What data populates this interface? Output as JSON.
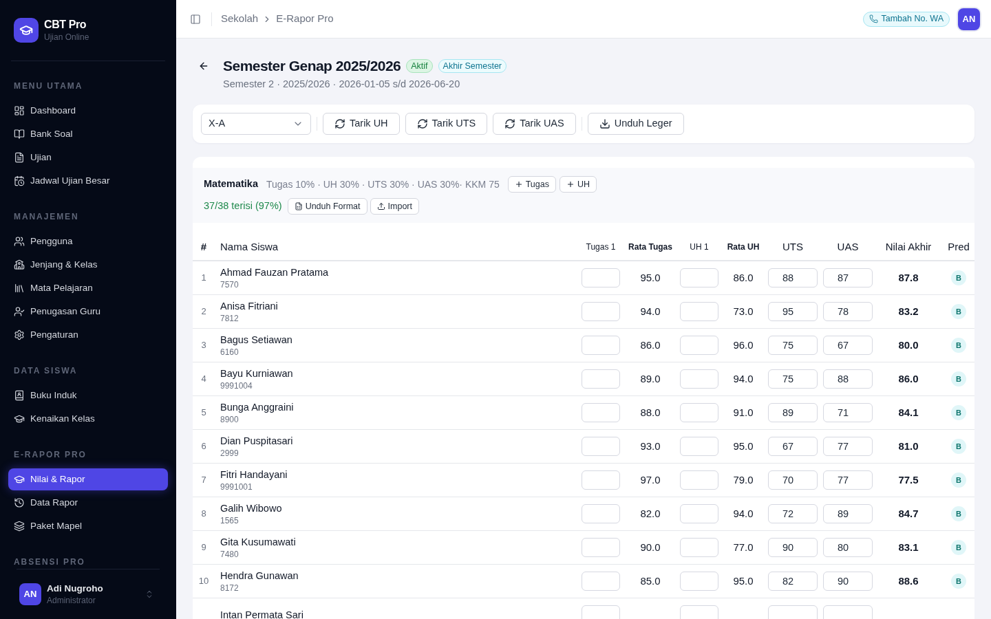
{
  "sidebar": {
    "brand": {
      "name": "CBT Pro",
      "tagline": "Ujian Online"
    },
    "sections": [
      {
        "title": "MENU UTAMA",
        "items": [
          {
            "label": "Dashboard",
            "selected": false
          },
          {
            "label": "Bank Soal",
            "selected": false
          },
          {
            "label": "Ujian",
            "selected": false
          },
          {
            "label": "Jadwal Ujian Besar",
            "selected": false
          }
        ]
      },
      {
        "title": "MANAJEMEN",
        "items": [
          {
            "label": "Pengguna",
            "selected": false
          },
          {
            "label": "Jenjang & Kelas",
            "selected": false
          },
          {
            "label": "Mata Pelajaran",
            "selected": false
          },
          {
            "label": "Penugasan Guru",
            "selected": false
          },
          {
            "label": "Pengaturan",
            "selected": false
          }
        ]
      },
      {
        "title": "DATA SISWA",
        "items": [
          {
            "label": "Buku Induk",
            "selected": false
          },
          {
            "label": "Kenaikan Kelas",
            "selected": false
          }
        ]
      },
      {
        "title": "E-RAPOR PRO",
        "items": [
          {
            "label": "Nilai & Rapor",
            "selected": true
          },
          {
            "label": "Data Rapor",
            "selected": false
          },
          {
            "label": "Paket Mapel",
            "selected": false
          }
        ]
      },
      {
        "title": "ABSENSI PRO"
      }
    ],
    "user": {
      "initials": "AN",
      "name": "Adi Nugroho",
      "role": "Administrator"
    }
  },
  "top_bar": {
    "breadcrumb": [
      "Sekolah",
      "E-Rapor Pro"
    ],
    "wa_button": "Tambah No. WA",
    "avatar": "AN"
  },
  "page": {
    "title": "Semester Genap 2025/2026",
    "badges": [
      {
        "label": "Aktif",
        "kind": "status"
      },
      {
        "label": "Akhir Semester",
        "kind": "period"
      }
    ],
    "subtitle": "Semester 2 · 2025/2026 · 2026-01-05 s/d 2026-06-20"
  },
  "toolbar": {
    "class_select": "X-A",
    "pull_buttons": [
      "Tarik UH",
      "Tarik UTS",
      "Tarik UAS"
    ],
    "export_button": "Unduh Leger"
  },
  "grades": {
    "subject": "Matematika",
    "weights": "Tugas 10% · UH 30% · UTS 30% · UAS 30%· KKM 75",
    "add_buttons": [
      "Tugas",
      "UH"
    ],
    "progress": "37/38 terisi (97%)",
    "format_button": "Unduh Format",
    "import_button": "Import",
    "table": {
      "columns": [
        {
          "label": "#",
          "kind": "index"
        },
        {
          "label": "Nama Siswa",
          "kind": "student"
        },
        {
          "label": "Tugas 1",
          "kind": "assignment"
        },
        {
          "label": "Rata Tugas",
          "kind": "average"
        },
        {
          "label": "UH 1",
          "kind": "assignment"
        },
        {
          "label": "Rata UH",
          "kind": "average"
        },
        {
          "label": "UTS",
          "kind": "exam"
        },
        {
          "label": "UAS",
          "kind": "exam"
        },
        {
          "label": "Nilai Akhir",
          "kind": "final"
        },
        {
          "label": "Pred",
          "kind": "predicate"
        }
      ],
      "rows": [
        {
          "no": "1",
          "name": "Ahmad Fauzan Pratama",
          "nis": "7570",
          "rata_tugas": "95.0",
          "rata_uh": "86.0",
          "uts": "88",
          "uas": "87",
          "nilai_akhir": "87.8",
          "pred": "B"
        },
        {
          "no": "2",
          "name": "Anisa Fitriani",
          "nis": "7812",
          "rata_tugas": "94.0",
          "rata_uh": "73.0",
          "uts": "95",
          "uas": "78",
          "nilai_akhir": "83.2",
          "pred": "B"
        },
        {
          "no": "3",
          "name": "Bagus Setiawan",
          "nis": "6160",
          "rata_tugas": "86.0",
          "rata_uh": "96.0",
          "uts": "75",
          "uas": "67",
          "nilai_akhir": "80.0",
          "pred": "B"
        },
        {
          "no": "4",
          "name": "Bayu Kurniawan",
          "nis": "9991004",
          "rata_tugas": "89.0",
          "rata_uh": "94.0",
          "uts": "75",
          "uas": "88",
          "nilai_akhir": "86.0",
          "pred": "B"
        },
        {
          "no": "5",
          "name": "Bunga Anggraini",
          "nis": "8900",
          "rata_tugas": "88.0",
          "rata_uh": "91.0",
          "uts": "89",
          "uas": "71",
          "nilai_akhir": "84.1",
          "pred": "B"
        },
        {
          "no": "6",
          "name": "Dian Puspitasari",
          "nis": "2999",
          "rata_tugas": "93.0",
          "rata_uh": "95.0",
          "uts": "67",
          "uas": "77",
          "nilai_akhir": "81.0",
          "pred": "B"
        },
        {
          "no": "7",
          "name": "Fitri Handayani",
          "nis": "9991001",
          "rata_tugas": "97.0",
          "rata_uh": "79.0",
          "uts": "70",
          "uas": "77",
          "nilai_akhir": "77.5",
          "pred": "B"
        },
        {
          "no": "8",
          "name": "Galih Wibowo",
          "nis": "1565",
          "rata_tugas": "82.0",
          "rata_uh": "94.0",
          "uts": "72",
          "uas": "89",
          "nilai_akhir": "84.7",
          "pred": "B"
        },
        {
          "no": "9",
          "name": "Gita Kusumawati",
          "nis": "7480",
          "rata_tugas": "90.0",
          "rata_uh": "77.0",
          "uts": "90",
          "uas": "80",
          "nilai_akhir": "83.1",
          "pred": "B"
        },
        {
          "no": "10",
          "name": "Hendra Gunawan",
          "nis": "8172",
          "rata_tugas": "85.0",
          "rata_uh": "95.0",
          "uts": "82",
          "uas": "90",
          "nilai_akhir": "88.6",
          "pred": "B"
        },
        {
          "name": "Intan Permata Sari"
        }
      ]
    }
  }
}
